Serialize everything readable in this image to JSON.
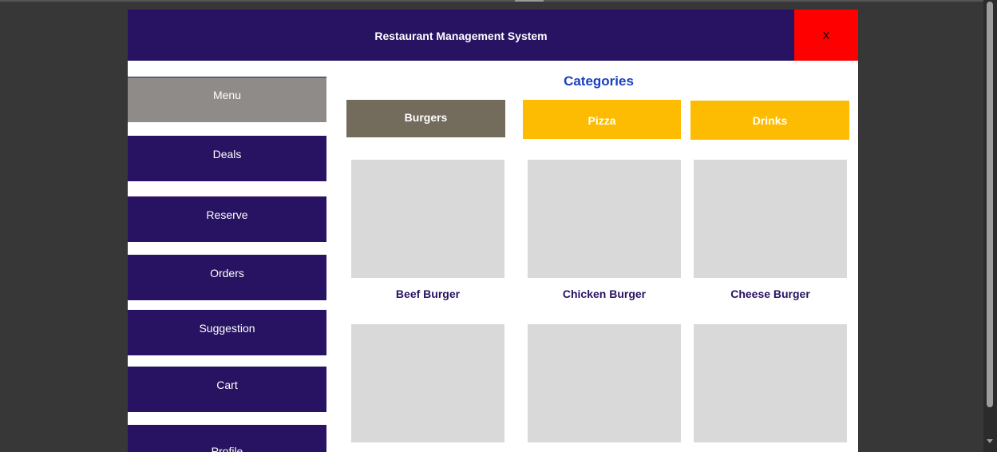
{
  "window": {
    "title": "Restaurant Management System",
    "close_label": "X"
  },
  "sidebar": {
    "items": [
      {
        "label": "Menu",
        "active": true
      },
      {
        "label": "Deals"
      },
      {
        "label": "Reserve"
      },
      {
        "label": "Orders"
      },
      {
        "label": "Suggestion"
      },
      {
        "label": "Cart"
      },
      {
        "label": "Profile"
      }
    ]
  },
  "main": {
    "heading": "Categories",
    "categories": [
      {
        "label": "Burgers",
        "selected": true
      },
      {
        "label": "Pizza"
      },
      {
        "label": "Drinks"
      }
    ],
    "items": [
      {
        "name": "Beef Burger"
      },
      {
        "name": "Chicken Burger"
      },
      {
        "name": "Cheese Burger"
      },
      {
        "name": ""
      },
      {
        "name": ""
      },
      {
        "name": ""
      }
    ]
  },
  "colors": {
    "brand": "#271361",
    "close": "#ff0000",
    "category_selected": "#736b5b",
    "category_default": "#fdbc01",
    "nav_active": "#8f8b89",
    "heading": "#1a3fc0",
    "placeholder": "#d9d9d9"
  },
  "icons": {
    "scroll_down": "chevron-down-icon"
  }
}
